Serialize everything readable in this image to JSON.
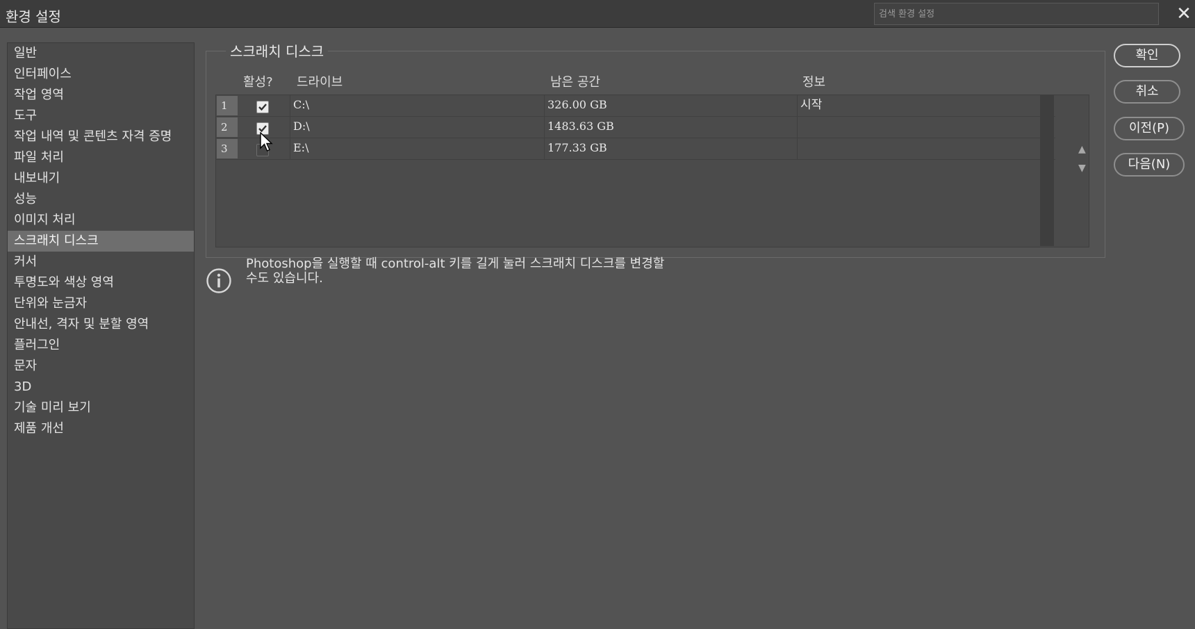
{
  "window": {
    "title": "환경 설정",
    "search_placeholder": "검색 환경 설정",
    "close_glyph": "✕"
  },
  "sidebar": {
    "items": [
      {
        "label": "일반"
      },
      {
        "label": "인터페이스"
      },
      {
        "label": "작업 영역"
      },
      {
        "label": "도구"
      },
      {
        "label": "작업 내역 및 콘텐츠 자격 증명"
      },
      {
        "label": "파일 처리"
      },
      {
        "label": "내보내기"
      },
      {
        "label": "성능"
      },
      {
        "label": "이미지 처리"
      },
      {
        "label": "스크래치 디스크",
        "active": true
      },
      {
        "label": "커서"
      },
      {
        "label": "투명도와 색상 영역"
      },
      {
        "label": "단위와 눈금자"
      },
      {
        "label": "안내선, 격자 및 분할 영역"
      },
      {
        "label": "플러그인"
      },
      {
        "label": "문자"
      },
      {
        "label": "3D"
      },
      {
        "label": "기술 미리 보기"
      },
      {
        "label": "제품 개선"
      }
    ]
  },
  "scratch": {
    "group_title": "스크래치 디스크",
    "columns": {
      "active": "활성?",
      "drive": "드라이브",
      "space": "남은 공간",
      "info": "정보"
    },
    "rows": [
      {
        "num": "1",
        "checked": true,
        "drive": "C:\\",
        "space": "326.00 GB",
        "info": "시작"
      },
      {
        "num": "2",
        "checked": true,
        "drive": "D:\\",
        "space": "1483.63 GB",
        "info": ""
      },
      {
        "num": "3",
        "checked": false,
        "drive": "E:\\",
        "space": "177.33 GB",
        "info": ""
      }
    ],
    "move_up": "▲",
    "move_down": "▼"
  },
  "buttons": {
    "ok": "확인",
    "cancel": "취소",
    "prev": "이전(P)",
    "next": "다음(N)"
  },
  "note": {
    "line1": "Photoshop을 실행할 때 control-alt 키를 길게 눌러 스크래치 디스크를 변경할",
    "line2": "수도 있습니다."
  },
  "colors": {
    "background": "#535353",
    "titlebar": "#3c3c3c",
    "sidebar": "#494949",
    "active_item": "#6e6e6e"
  }
}
